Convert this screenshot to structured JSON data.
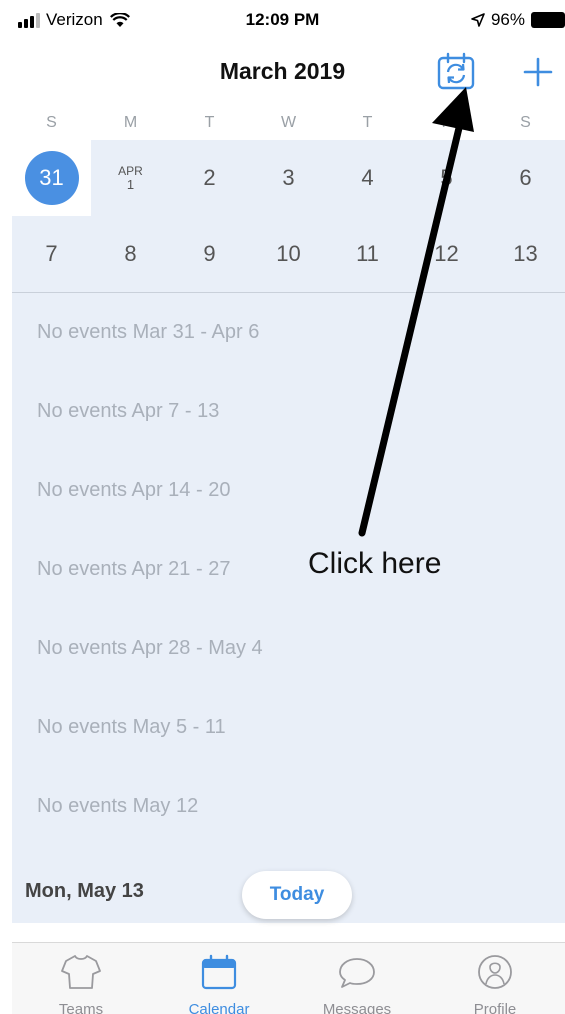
{
  "status_bar": {
    "carrier": "Verizon",
    "time": "12:09 PM",
    "battery": "96%"
  },
  "header": {
    "title": "March 2019"
  },
  "weekdays": [
    "S",
    "M",
    "T",
    "W",
    "T",
    "F",
    "S"
  ],
  "calendar": {
    "week1": {
      "selected": "31",
      "apr_month": "APR",
      "apr_day": "1",
      "days": [
        "2",
        "3",
        "4",
        "5",
        "6"
      ]
    },
    "week2": [
      "7",
      "8",
      "9",
      "10",
      "11",
      "12",
      "13"
    ]
  },
  "events": [
    "No events Mar 31 - Apr 6",
    "No events Apr 7 - 13",
    "No events Apr 14 - 20",
    "No events Apr 21 - 27",
    "No events Apr 28 - May 4",
    "No events May 5 - 11",
    "No events May 12"
  ],
  "current_date": "Mon, May 13",
  "today_label": "Today",
  "tabs": [
    {
      "label": "Teams",
      "icon": "jersey-icon"
    },
    {
      "label": "Calendar",
      "icon": "calendar-icon",
      "active": true
    },
    {
      "label": "Messages",
      "icon": "chat-bubble-icon"
    },
    {
      "label": "Profile",
      "icon": "profile-icon"
    }
  ],
  "annotation": {
    "text": "Click here"
  },
  "colors": {
    "accent": "#3e8de0",
    "selected_day": "#4a90e2",
    "calendar_bg": "#e9eff8"
  }
}
